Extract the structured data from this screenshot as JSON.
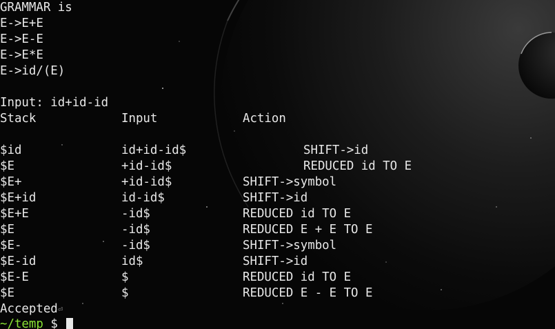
{
  "grammar": {
    "header": "GRAMMAR is",
    "rules": [
      "E->E+E",
      "E->E-E",
      "E->E*E",
      "E->id/(E)"
    ]
  },
  "input_line": "Input: id+id-id",
  "table": {
    "headers": [
      "Stack",
      "Input",
      "Action"
    ],
    "rows": [
      {
        "stack": "$id",
        "input": "id+id-id$",
        "action": "SHIFT->id"
      },
      {
        "stack": "$E",
        "input": "+id-id$",
        "action": "REDUCED id TO E"
      },
      {
        "stack": "$E+",
        "input": "+id-id$",
        "action": "SHIFT->symbol"
      },
      {
        "stack": "$E+id",
        "input": "id-id$",
        "action": "SHIFT->id"
      },
      {
        "stack": "$E+E",
        "input": "-id$",
        "action": "REDUCED id TO E"
      },
      {
        "stack": "$E",
        "input": "-id$",
        "action": "REDUCED E + E TO E"
      },
      {
        "stack": "$E-",
        "input": "-id$",
        "action": "SHIFT->symbol"
      },
      {
        "stack": "$E-id",
        "input": "id$",
        "action": "SHIFT->id"
      },
      {
        "stack": "$E-E",
        "input": "$",
        "action": "REDUCED id TO E"
      },
      {
        "stack": "$E",
        "input": "$",
        "action": "REDUCED E - E TO E"
      }
    ]
  },
  "result": "Accepted",
  "newline_glyph": "⏎",
  "prompt": {
    "path": "~/temp",
    "symbol": "$"
  }
}
